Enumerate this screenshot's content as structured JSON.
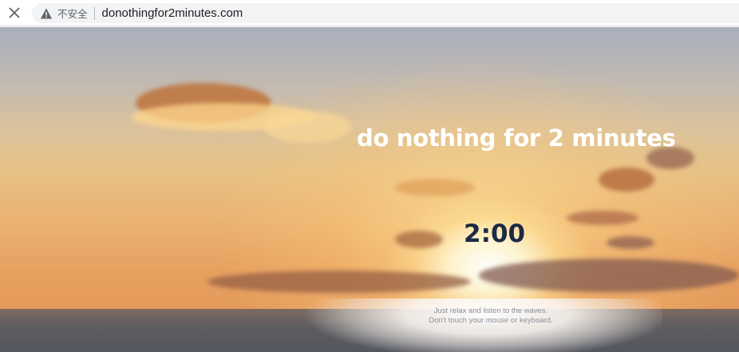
{
  "browser": {
    "close_icon": "close-icon",
    "security_icon": "warning-triangle-icon",
    "security_label": "不安全",
    "url": "donothingfor2minutes.com"
  },
  "page": {
    "title": "do nothing for 2 minutes",
    "timer": "2:00",
    "hint_line1": "Just relax and listen to the waves.",
    "hint_line2": "Don't touch your mouse or keyboard."
  },
  "colors": {
    "timer_text": "#1d2a45",
    "title_text": "#ffffff",
    "sky_top": "#a9b0bc",
    "sunset_orange": "#e39a5c"
  }
}
